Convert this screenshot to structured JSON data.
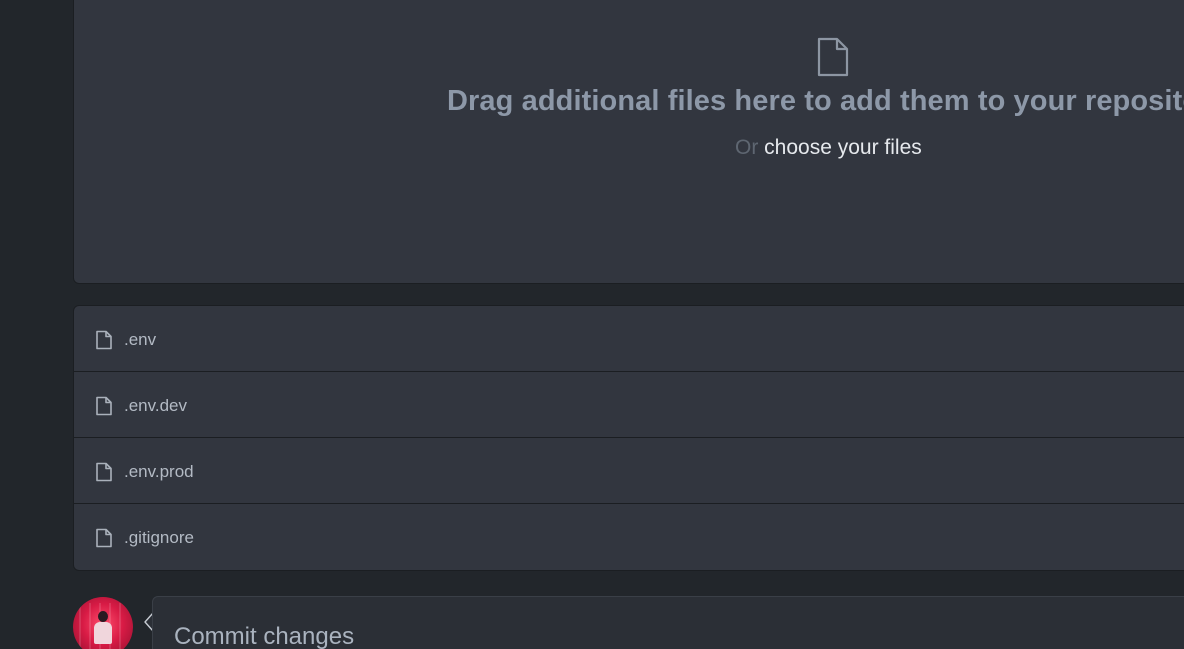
{
  "dropzone": {
    "icon": "file-icon",
    "title": "Drag additional files here to add them to your repository",
    "or_text": "Or",
    "choose_link": "choose your files"
  },
  "files": [
    {
      "icon": "file-icon",
      "name": ".env"
    },
    {
      "icon": "file-icon",
      "name": ".env.dev"
    },
    {
      "icon": "file-icon",
      "name": ".env.prod"
    },
    {
      "icon": "file-icon",
      "name": ".gitignore"
    }
  ],
  "commit": {
    "avatar_icon": "user-avatar",
    "title": "Commit changes"
  },
  "colors": {
    "background": "#22262b",
    "panel": "#32363f",
    "muted_text": "#8d98a8",
    "link_text": "#e6e9ed"
  }
}
